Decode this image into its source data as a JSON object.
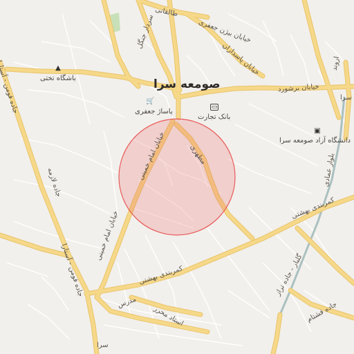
{
  "map": {
    "city_label": "صومعه سرا",
    "circle_color": "#e85a5a",
    "road_color": "#f6d889",
    "road_edge_color": "#e8c46a",
    "rail_color": "#aac0c0"
  },
  "pois": {
    "bank": {
      "label": "بانک تجارت",
      "icon": "bank-icon"
    },
    "passage": {
      "label": "پاساژ جعفری",
      "icon": "shopping-cart-icon"
    },
    "club": {
      "label": "باشگاه تختی",
      "icon": "gym-icon"
    },
    "university": {
      "label": "دانشگاه آزاد صومعه سرا",
      "icon": "university-icon"
    }
  },
  "roads": {
    "taleghani": "طالقانی",
    "bijan_jafari": "خیابان بیژن جعفری",
    "sardar_jangal": "سردار جنگل",
    "khiaban_pasdaran": "خیابان پاسداران",
    "boroshvord": "خیابان برشورد",
    "sara_east": "سرا",
    "motahari": "مطهری",
    "imam_khomeini_1": "خیابان امام خمینی",
    "imam_khomeini_2": "خیابان امام خمینی",
    "fooman_astara_1": "جاده فومن - آستارا",
    "fooman_astara_2": "جاده فومن - آستارا",
    "jadelazemeh": "جاده لازمه",
    "behashti_1": "کمربندی بهشتی",
    "behashti_2": "کمربندی بهشتی",
    "modares": "مدرس",
    "ostad_moharrar": "استاد محرر",
    "fashtam": "جاده فشتام",
    "golbar": "گلبار - جاده تراز",
    "bolvar_emaadi": "بلوار عمادی",
    "sara_bottom": "سرا",
    "arvand": "اروند"
  }
}
